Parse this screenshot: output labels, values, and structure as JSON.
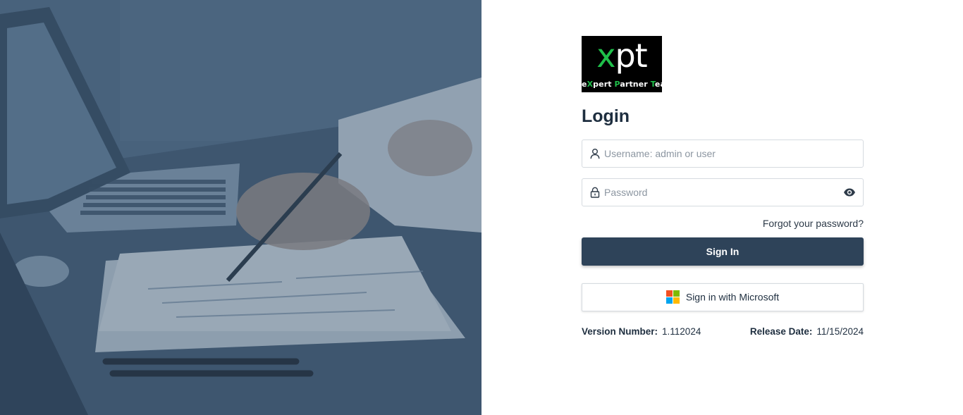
{
  "logo": {
    "mark_x": "x",
    "mark_rest": "pt",
    "tagline": [
      {
        "text": "e",
        "green": false
      },
      {
        "text": "X",
        "green": true
      },
      {
        "text": "pert ",
        "green": false
      },
      {
        "text": "P",
        "green": true
      },
      {
        "text": "artner ",
        "green": false
      },
      {
        "text": "T",
        "green": true
      },
      {
        "text": "eam",
        "green": false
      }
    ],
    "accent_color": "#1fbf4a"
  },
  "login": {
    "title": "Login",
    "username": {
      "value": "",
      "placeholder": "Username: admin or user",
      "icon": "user-icon"
    },
    "password": {
      "value": "",
      "placeholder": "Password",
      "icon": "lock-icon",
      "toggle_icon": "eye-icon"
    },
    "forgot_label": "Forgot your password?",
    "signin_label": "Sign In",
    "microsoft_label": "Sign in with Microsoft"
  },
  "meta": {
    "version_label": "Version Number:",
    "version_value": "1.112024",
    "release_label": "Release Date:",
    "release_value": "11/15/2024"
  },
  "colors": {
    "primary": "#2e4359",
    "hero_tint": "#4b6580",
    "ms_red": "#f25022",
    "ms_green": "#7fba00",
    "ms_blue": "#00a4ef",
    "ms_yellow": "#ffb900"
  }
}
